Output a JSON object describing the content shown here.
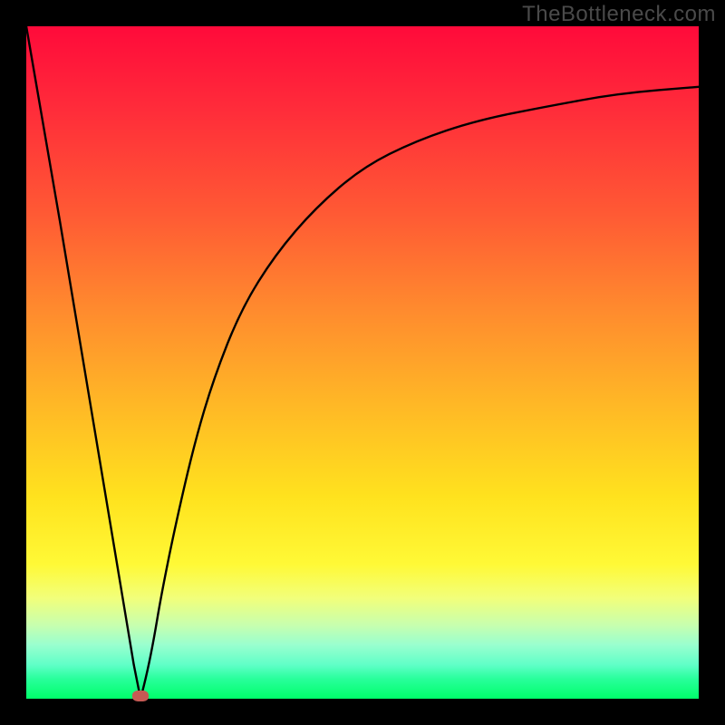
{
  "watermark": "TheBottleneck.com",
  "colors": {
    "background_frame": "#000000",
    "gradient_top": "#ff0a3a",
    "gradient_bottom": "#00ff6a",
    "curve": "#000000",
    "marker": "#c65a54"
  },
  "chart_data": {
    "type": "line",
    "title": "",
    "xlabel": "",
    "ylabel": "",
    "xlim": [
      0,
      100
    ],
    "ylim": [
      0,
      100
    ],
    "grid": false,
    "legend": false,
    "annotations": [
      {
        "label": "curve-minimum-marker",
        "x": 17,
        "y": 0
      }
    ],
    "series": [
      {
        "name": "bottleneck-curve",
        "segment": "descending",
        "x": [
          0,
          5,
          10,
          14,
          16,
          17
        ],
        "y": [
          100,
          71,
          41,
          17,
          5,
          0
        ]
      },
      {
        "name": "bottleneck-curve",
        "segment": "ascending",
        "x": [
          17,
          18,
          19,
          20,
          22,
          25,
          28,
          32,
          37,
          43,
          50,
          58,
          67,
          77,
          88,
          100
        ],
        "y": [
          0,
          4,
          9,
          15,
          25,
          38,
          48,
          58,
          66,
          73,
          79,
          83,
          86,
          88,
          90,
          91
        ]
      }
    ]
  }
}
